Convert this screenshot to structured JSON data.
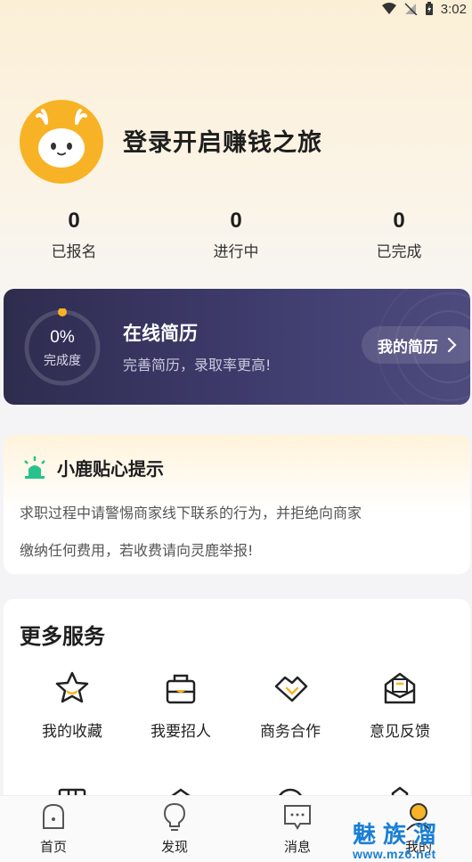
{
  "status_bar": {
    "time": "3:02"
  },
  "profile": {
    "title": "登录开启赚钱之旅"
  },
  "stats": [
    {
      "value": "0",
      "label": "已报名"
    },
    {
      "value": "0",
      "label": "进行中"
    },
    {
      "value": "0",
      "label": "已完成"
    }
  ],
  "resume": {
    "progress_percent": 0,
    "progress_text": "0%",
    "progress_label": "完成度",
    "title": "在线简历",
    "subtitle": "完善简历，录取率更高!",
    "button_label": "我的简历"
  },
  "tips": {
    "title": "小鹿贴心提示",
    "line1": "求职过程中请警惕商家线下联系的行为，并拒绝向商家",
    "line2": "缴纳任何费用，若收费请向灵鹿举报!"
  },
  "services": {
    "title": "更多服务",
    "items": [
      {
        "label": "我的收藏",
        "icon": "star-icon"
      },
      {
        "label": "我要招人",
        "icon": "recruit-icon"
      },
      {
        "label": "商务合作",
        "icon": "handshake-icon"
      },
      {
        "label": "意见反馈",
        "icon": "feedback-icon"
      }
    ]
  },
  "bottom_nav": [
    {
      "label": "首页",
      "icon": "home-icon"
    },
    {
      "label": "发现",
      "icon": "bulb-icon"
    },
    {
      "label": "消息",
      "icon": "message-icon"
    },
    {
      "label": "我的",
      "icon": "profile-icon"
    }
  ],
  "watermark": {
    "brand": "魅族溜",
    "url": "www.mz6.net"
  },
  "colors": {
    "accent": "#f7b325",
    "resume_card": "#3a3766",
    "tips_icon": "#26c28a",
    "watermark": "#1a7fd6"
  }
}
